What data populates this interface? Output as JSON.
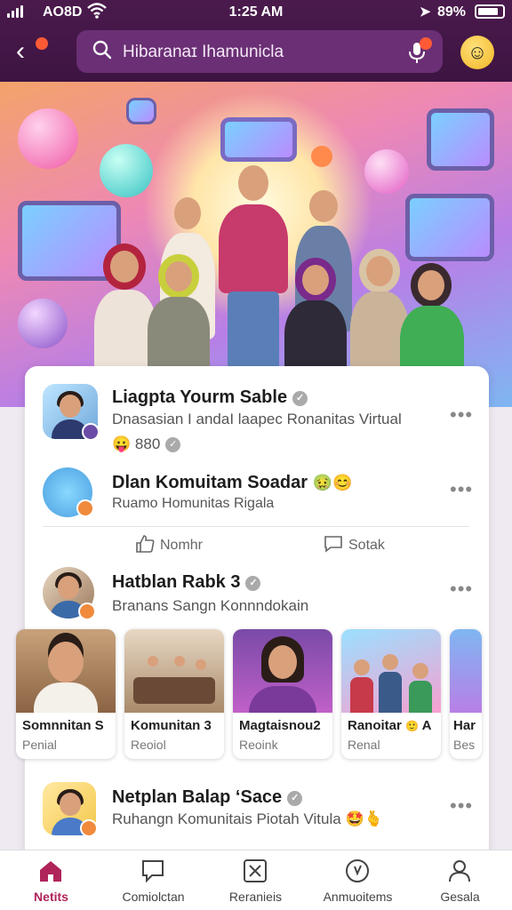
{
  "status": {
    "carrier": "AO8D",
    "time": "1:25 AM",
    "battery": "89%"
  },
  "header": {
    "search_text": "Hibaranaɪ Ihamunicla"
  },
  "feed": {
    "items": [
      {
        "title": "Liagpta Yourm Sable",
        "subtitle": "Dnasasian I andaI laapec Ronanitas Virtual",
        "meta": "880"
      },
      {
        "title": "Dlan Komuitam Soadar",
        "subtitle": "Ruamo Homunitas Rigala"
      },
      {
        "title": "Hatblan Rabk 3",
        "subtitle": "Branans Sangn Konnndokain"
      },
      {
        "title": "Netplan Balap ‘Sace",
        "subtitle": "Ruhangn Komunitais Piotah Vitula"
      }
    ],
    "actions": {
      "like": "Nomhr",
      "comment": "Sotak"
    },
    "thumbs": [
      {
        "title": "Somnnitan S",
        "subtitle": "Penial"
      },
      {
        "title": "Komunitan 3",
        "subtitle": "Reoiol"
      },
      {
        "title": "Magtaisnou2",
        "subtitle": "Reoink"
      },
      {
        "title": "Ranoitar",
        "badge": "A",
        "subtitle": "Renal"
      },
      {
        "title": "Har",
        "subtitle": "Bes"
      }
    ]
  },
  "nav": [
    {
      "label": "Netits",
      "icon": "home-icon",
      "active": true
    },
    {
      "label": "Comiolctan",
      "icon": "chat-icon"
    },
    {
      "label": "Reranieis",
      "icon": "sparkle-box-icon"
    },
    {
      "label": "Anmuoitems",
      "icon": "compass-icon"
    },
    {
      "label": "Gesala",
      "icon": "profile-icon"
    }
  ],
  "colors": {
    "header_bg": "#3d1442",
    "accent": "#b0245a",
    "notification_dot": "#ff5a36"
  }
}
